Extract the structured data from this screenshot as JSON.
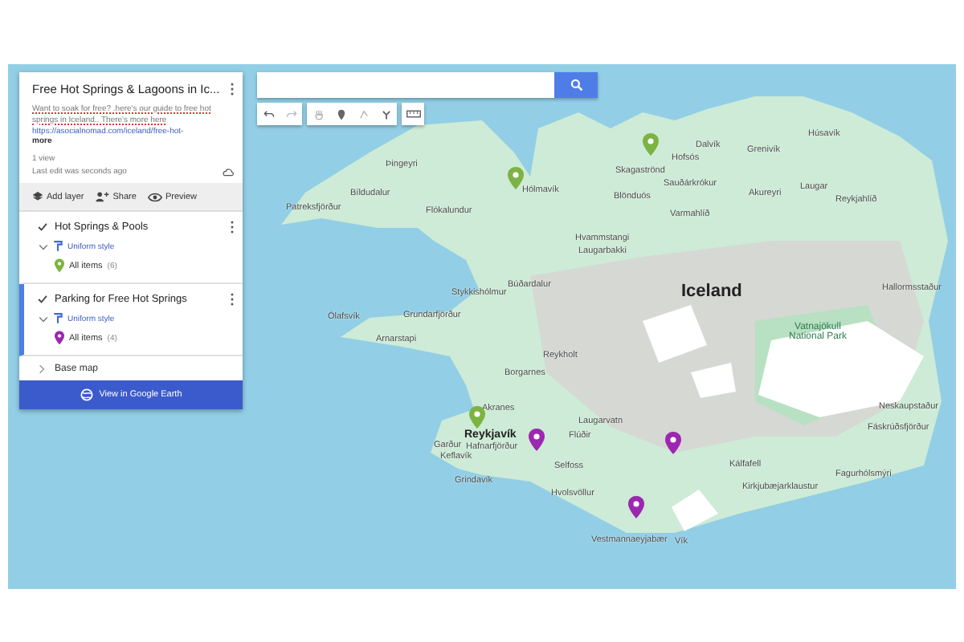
{
  "panel": {
    "title": "Free Hot Springs & Lagoons in Ic...",
    "description": "Want to soak for free? .here's our guide to free hot springs in Iceland.. There's more here",
    "link": "https://asocialnomad.com/iceland/free-hot-",
    "more": "more",
    "views": "1 view",
    "last_edit": "Last edit was seconds ago",
    "actions": [
      {
        "label": "Add layer",
        "kind": "layer"
      },
      {
        "label": "Share",
        "kind": "share"
      },
      {
        "label": "Preview",
        "kind": "preview"
      }
    ],
    "layers": [
      {
        "name": "Hot Springs & Pools",
        "checked": true,
        "selected": false,
        "style": "Uniform style",
        "items_label": "All items",
        "count": "(6)",
        "color": "#7cb342"
      },
      {
        "name": "Parking for Free Hot Springs",
        "checked": true,
        "selected": true,
        "style": "Uniform style",
        "items_label": "All items",
        "count": "(4)",
        "color": "#9c27b0"
      }
    ],
    "base_map": {
      "label": "Base map",
      "expanded": false
    },
    "earth_button": "View in Google Earth"
  },
  "map": {
    "labels": [
      {
        "name": "Þingeyri",
        "kind": "town"
      },
      {
        "name": "Bíldudalur",
        "kind": "town"
      },
      {
        "name": "Patreksfjörður",
        "kind": "town"
      },
      {
        "name": "Flókalundur",
        "kind": "town"
      },
      {
        "name": "Hólmavík",
        "kind": "town"
      },
      {
        "name": "Skagaströnd",
        "kind": "town"
      },
      {
        "name": "Hofsós",
        "kind": "town"
      },
      {
        "name": "Sauðárkrókur",
        "kind": "town"
      },
      {
        "name": "Blönduós",
        "kind": "town"
      },
      {
        "name": "Varmahlíð",
        "kind": "town"
      },
      {
        "name": "Dalvík",
        "kind": "town"
      },
      {
        "name": "Grenivík",
        "kind": "town"
      },
      {
        "name": "Húsavík",
        "kind": "town"
      },
      {
        "name": "Akureyri",
        "kind": "town"
      },
      {
        "name": "Laugar",
        "kind": "town"
      },
      {
        "name": "Reykjahlíð",
        "kind": "town"
      },
      {
        "name": "Hvammstangi",
        "kind": "town"
      },
      {
        "name": "Laugarbakki",
        "kind": "town"
      },
      {
        "name": "Búðardalur",
        "kind": "town"
      },
      {
        "name": "Stykkishólmur",
        "kind": "town"
      },
      {
        "name": "Ólafsvík",
        "kind": "town"
      },
      {
        "name": "Grundarfjörður",
        "kind": "town"
      },
      {
        "name": "Arnarstapi",
        "kind": "town"
      },
      {
        "name": "Reykholt",
        "kind": "town"
      },
      {
        "name": "Iceland",
        "kind": "country"
      },
      {
        "name": "Vatnajökull National Park",
        "kind": "park"
      },
      {
        "name": "Hallormsstaður",
        "kind": "town"
      },
      {
        "name": "Borgarnes",
        "kind": "town"
      },
      {
        "name": "Akranes",
        "kind": "town"
      },
      {
        "name": "Reykjavík",
        "kind": "capital"
      },
      {
        "name": "Hafnarfjörður",
        "kind": "town"
      },
      {
        "name": "Garður",
        "kind": "town"
      },
      {
        "name": "Keflavík",
        "kind": "town"
      },
      {
        "name": "Grindavík",
        "kind": "town"
      },
      {
        "name": "Laugarvatn",
        "kind": "town"
      },
      {
        "name": "Flúðir",
        "kind": "town"
      },
      {
        "name": "Selfoss",
        "kind": "town"
      },
      {
        "name": "Hvolsvöllur",
        "kind": "town"
      },
      {
        "name": "Vestmannaeyjabær",
        "kind": "town"
      },
      {
        "name": "Vík",
        "kind": "town"
      },
      {
        "name": "Kálfafell",
        "kind": "town"
      },
      {
        "name": "Kirkjubæjarklaustur",
        "kind": "town"
      },
      {
        "name": "Fagurhólsmýri",
        "kind": "town"
      },
      {
        "name": "Neskaupstaður",
        "kind": "town"
      },
      {
        "name": "Fáskrúðsfjörður",
        "kind": "town"
      }
    ],
    "pins": [
      {
        "color": "#7cb342"
      },
      {
        "color": "#7cb342"
      },
      {
        "color": "#7cb342"
      },
      {
        "color": "#9c27b0"
      },
      {
        "color": "#9c27b0"
      },
      {
        "color": "#9c27b0"
      }
    ]
  }
}
